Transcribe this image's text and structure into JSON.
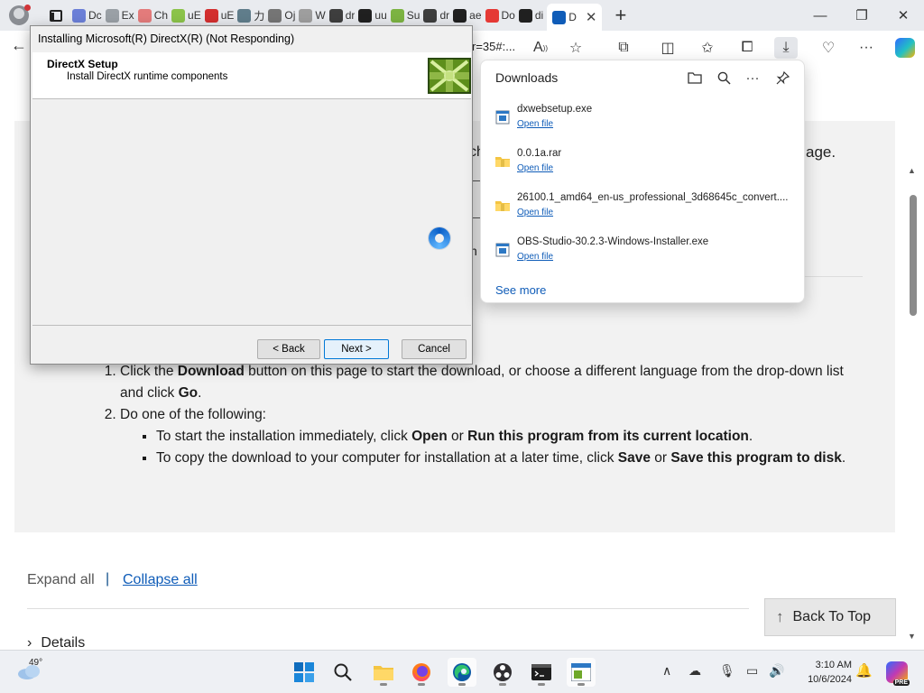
{
  "browser": {
    "tabs": [
      {
        "label": "Dc",
        "fav_color": "#6b7fd7"
      },
      {
        "label": "Ex",
        "fav_color": "#9aa0a6"
      },
      {
        "label": "Ch",
        "fav_color": "#e37b7b"
      },
      {
        "label": "uE",
        "fav_color": "#8bc34a"
      },
      {
        "label": "uE",
        "fav_color": "#d32f2f"
      },
      {
        "label": "力",
        "fav_color": "#607d8b"
      },
      {
        "label": "Oj",
        "fav_color": "#757575"
      },
      {
        "label": "W",
        "fav_color": "#9e9e9e"
      },
      {
        "label": "dr",
        "fav_color": "#3e3e3e"
      },
      {
        "label": "uu",
        "fav_color": "#202020"
      },
      {
        "label": "Su",
        "fav_color": "#7cb342"
      },
      {
        "label": "dr",
        "fav_color": "#3e3e3e"
      },
      {
        "label": "ae",
        "fav_color": "#202020"
      },
      {
        "label": "Do",
        "fav_color": "#e53935"
      },
      {
        "label": "di",
        "fav_color": "#202020"
      }
    ],
    "active_tab": {
      "label": "D"
    },
    "address_tail": "r=35#:..."
  },
  "dialog": {
    "title": "Installing Microsoft(R) DirectX(R) (Not Responding)",
    "header_title": "DirectX Setup",
    "header_subtitle": "Install DirectX runtime components",
    "back_label": "< Back",
    "next_label": "Next >",
    "cancel_label": "Cancel"
  },
  "downloads": {
    "title": "Downloads",
    "items": [
      {
        "name": "dxwebsetup.exe",
        "action": "Open file",
        "kind": "exe"
      },
      {
        "name": "0.0.1a.rar",
        "action": "Open file",
        "kind": "folder"
      },
      {
        "name": "26100.1_amd64_en-us_professional_3d68645c_convert....",
        "action": "Open file",
        "kind": "folder"
      },
      {
        "name": "OBS-Studio-30.2.3-Windows-Installer.exe",
        "action": "Open file",
        "kind": "exe"
      }
    ],
    "see_more": "See more"
  },
  "page": {
    "fragment_left": "ch",
    "fragment_right": "age.",
    "fragment_n": "n",
    "step1_text_a": "Click the ",
    "step1_bold_a": "Download",
    "step1_text_b": " button on this page to start the download, or choose a different language from the drop-down list and click ",
    "step1_bold_b": "Go",
    "step1_text_c": ".",
    "step2_text": "Do one of the following:",
    "bullet1_text_a": "To start the installation immediately, click ",
    "bullet1_bold_a": "Open",
    "bullet1_text_b": " or ",
    "bullet1_bold_b": "Run this program from its current location",
    "bullet1_text_c": ".",
    "bullet2_text_a": "To copy the download to your computer for installation at a later time, click ",
    "bullet2_bold_a": "Save",
    "bullet2_text_b": " or ",
    "bullet2_bold_b": "Save this program to disk",
    "bullet2_text_c": ".",
    "expand_all": "Expand all",
    "separator": "|",
    "collapse_all": "Collapse all",
    "details": "Details",
    "back_to_top": "Back To Top"
  },
  "taskbar": {
    "temperature": "49°",
    "time": "3:10 AM",
    "date": "10/6/2024",
    "copilot_badge": "PRE"
  }
}
